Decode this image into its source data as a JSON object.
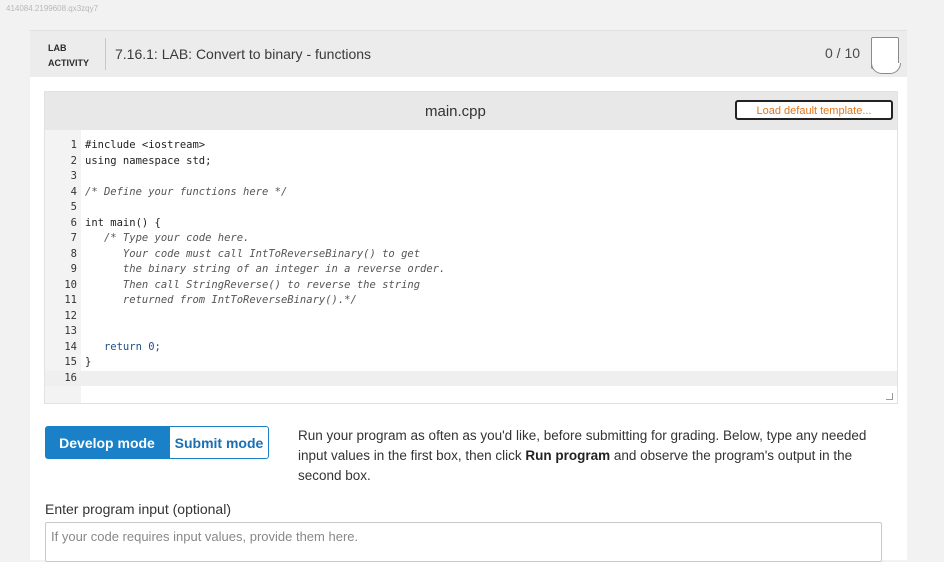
{
  "watermark": "414084.2199608.qx3zqy7",
  "lab": {
    "label_line1": "LAB",
    "label_line2": "ACTIVITY",
    "title": "7.16.1: LAB: Convert to binary - functions",
    "score": "0 / 10"
  },
  "editor": {
    "filename": "main.cpp",
    "load_button": "Load default template...",
    "lines": [
      {
        "n": "1",
        "text": "#include <iostream>"
      },
      {
        "n": "2",
        "text": "using namespace std;"
      },
      {
        "n": "3",
        "text": ""
      },
      {
        "n": "4",
        "text": "/* Define your functions here */"
      },
      {
        "n": "5",
        "text": ""
      },
      {
        "n": "6",
        "text": "int main() {"
      },
      {
        "n": "7",
        "text": "   /* Type your code here."
      },
      {
        "n": "8",
        "text": "      Your code must call IntToReverseBinary() to get"
      },
      {
        "n": "9",
        "text": "      the binary string of an integer in a reverse order."
      },
      {
        "n": "10",
        "text": "      Then call StringReverse() to reverse the string"
      },
      {
        "n": "11",
        "text": "      returned from IntToReverseBinary().*/"
      },
      {
        "n": "12",
        "text": ""
      },
      {
        "n": "13",
        "text": ""
      },
      {
        "n": "14",
        "text": "   return 0;"
      },
      {
        "n": "15",
        "text": "}"
      },
      {
        "n": "16",
        "text": ""
      }
    ]
  },
  "modes": {
    "develop": "Develop mode",
    "submit": "Submit mode"
  },
  "instructions": {
    "part1": "Run your program as often as you'd like, before submitting for grading. Below, type any needed input values in the first box, then click ",
    "bold": "Run program",
    "part2": " and observe the program's output in the second box."
  },
  "input": {
    "label": "Enter program input (optional)",
    "placeholder": "If your code requires input values, provide them here."
  },
  "colors": {
    "accent_blue": "#1a80c7",
    "load_button_text": "#e0761a"
  }
}
